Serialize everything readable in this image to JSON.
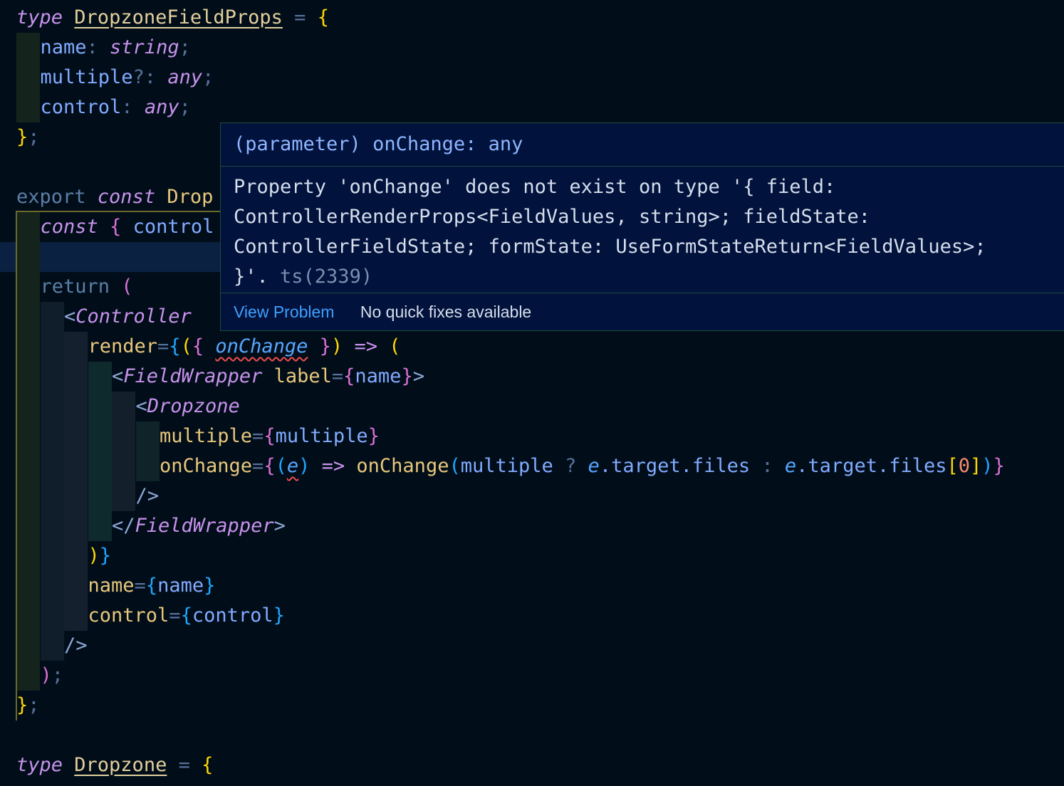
{
  "editor": {
    "lines": [
      {
        "tokens": [
          [
            "t-kw2",
            "type"
          ],
          [
            "",
            ""
          ],
          [
            "t-type",
            "DropzoneFieldProps"
          ],
          [
            "t-punc",
            " = "
          ],
          [
            "t-brace",
            "{"
          ]
        ]
      },
      {
        "tokens": [
          [
            "t-prop",
            "name"
          ],
          [
            "t-punc",
            ": "
          ],
          [
            "t-type-i",
            "string"
          ],
          [
            "t-punc",
            ";"
          ]
        ]
      },
      {
        "tokens": [
          [
            "t-prop",
            "multiple"
          ],
          [
            "t-punc",
            "?: "
          ],
          [
            "t-type-i",
            "any"
          ],
          [
            "t-punc",
            ";"
          ]
        ]
      },
      {
        "tokens": [
          [
            "t-prop",
            "control"
          ],
          [
            "t-punc",
            ": "
          ],
          [
            "t-type-i",
            "any"
          ],
          [
            "t-punc",
            ";"
          ]
        ]
      },
      {
        "tokens": [
          [
            "t-brace",
            "}"
          ],
          [
            "t-punc",
            ";"
          ]
        ]
      },
      {
        "tokens": []
      },
      {
        "tokens": [
          [
            "t-kw",
            "export "
          ],
          [
            "t-kw2",
            "const "
          ],
          [
            "t-attr",
            "Drop"
          ]
        ]
      },
      {
        "tokens": [
          [
            "t-kw2",
            "const "
          ],
          [
            "t-brace2",
            "{ "
          ],
          [
            "t-var",
            "control"
          ]
        ]
      },
      {
        "tokens": []
      },
      {
        "tokens": [
          [
            "t-kw",
            "return "
          ],
          [
            "t-brace2",
            "("
          ]
        ]
      },
      {
        "tokens": [
          [
            "t-angle",
            "<"
          ],
          [
            "t-tag",
            "Controller"
          ]
        ]
      },
      {
        "tokens": [
          [
            "t-attr",
            "render"
          ],
          [
            "t-punc",
            "="
          ],
          [
            "t-brace3",
            "{"
          ],
          [
            "t-brace",
            "("
          ],
          [
            "t-brace2",
            "{ "
          ],
          [
            "t-param squiggle",
            "onChange"
          ],
          [
            "t-brace2",
            " }"
          ],
          [
            "t-brace",
            ")"
          ],
          [
            "t-op",
            " => "
          ],
          [
            "t-brace",
            "("
          ]
        ]
      },
      {
        "tokens": [
          [
            "t-angle",
            "<"
          ],
          [
            "t-tag",
            "FieldWrapper "
          ],
          [
            "t-attr",
            "label"
          ],
          [
            "t-punc",
            "="
          ],
          [
            "t-brace2",
            "{"
          ],
          [
            "t-var",
            "name"
          ],
          [
            "t-brace2",
            "}"
          ],
          [
            "t-angle",
            ">"
          ]
        ]
      },
      {
        "tokens": [
          [
            "t-angle",
            "<"
          ],
          [
            "t-tag",
            "Dropzone"
          ]
        ]
      },
      {
        "tokens": [
          [
            "t-attr",
            "multiple"
          ],
          [
            "t-punc",
            "="
          ],
          [
            "t-brace2",
            "{"
          ],
          [
            "t-var",
            "multiple"
          ],
          [
            "t-brace2",
            "}"
          ]
        ]
      },
      {
        "tokens": [
          [
            "t-attr",
            "onChange"
          ],
          [
            "t-punc",
            "="
          ],
          [
            "t-brace2",
            "{"
          ],
          [
            "t-brace3",
            "("
          ],
          [
            "t-param squiggle",
            "e"
          ],
          [
            "t-brace3",
            ")"
          ],
          [
            "t-op",
            " => "
          ],
          [
            "t-fn",
            "onChange"
          ],
          [
            "t-brace3",
            "("
          ],
          [
            "t-var",
            "multiple "
          ],
          [
            "t-punc",
            "? "
          ],
          [
            "t-param",
            "e"
          ],
          [
            "t-var",
            ".target.files "
          ],
          [
            "t-punc",
            ": "
          ],
          [
            "t-param",
            "e"
          ],
          [
            "t-var",
            ".target.files"
          ],
          [
            "t-brace",
            "["
          ],
          [
            "t-num",
            "0"
          ],
          [
            "t-brace",
            "]"
          ],
          [
            "t-brace3",
            ")"
          ],
          [
            "t-brace2",
            "}"
          ]
        ]
      },
      {
        "tokens": [
          [
            "t-angle",
            "/>"
          ]
        ]
      },
      {
        "tokens": [
          [
            "t-angle",
            "</"
          ],
          [
            "t-tag",
            "FieldWrapper"
          ],
          [
            "t-angle",
            ">"
          ]
        ]
      },
      {
        "tokens": [
          [
            "t-brace",
            ")"
          ],
          [
            "t-brace3",
            "}"
          ]
        ]
      },
      {
        "tokens": [
          [
            "t-attr",
            "name"
          ],
          [
            "t-punc",
            "="
          ],
          [
            "t-brace3",
            "{"
          ],
          [
            "t-var",
            "name"
          ],
          [
            "t-brace3",
            "}"
          ]
        ]
      },
      {
        "tokens": [
          [
            "t-attr",
            "control"
          ],
          [
            "t-punc",
            "="
          ],
          [
            "t-brace3",
            "{"
          ],
          [
            "t-var",
            "control"
          ],
          [
            "t-brace3",
            "}"
          ]
        ]
      },
      {
        "tokens": [
          [
            "t-angle",
            "/>"
          ]
        ]
      },
      {
        "tokens": [
          [
            "t-brace2",
            ")"
          ],
          [
            "t-punc",
            ";"
          ]
        ]
      },
      {
        "tokens": [
          [
            "t-brace",
            "}"
          ],
          [
            "t-punc",
            ";"
          ]
        ]
      },
      {
        "tokens": []
      },
      {
        "tokens": [
          [
            "t-kw2",
            "type "
          ],
          [
            "t-type",
            "Dropzone"
          ],
          [
            "t-punc",
            " = "
          ],
          [
            "t-brace",
            "{"
          ]
        ]
      }
    ]
  },
  "hover": {
    "signature": "(parameter) onChange: any",
    "message": "Property 'onChange' does not exist on type '{ field:\nControllerRenderProps<FieldValues, string>; fieldState:\nControllerFieldState; formState: UseFormStateReturn<FieldValues>;\n}'. ",
    "code": "ts(2339)",
    "view_problem": "View Problem",
    "no_fixes": "No quick fixes available"
  }
}
